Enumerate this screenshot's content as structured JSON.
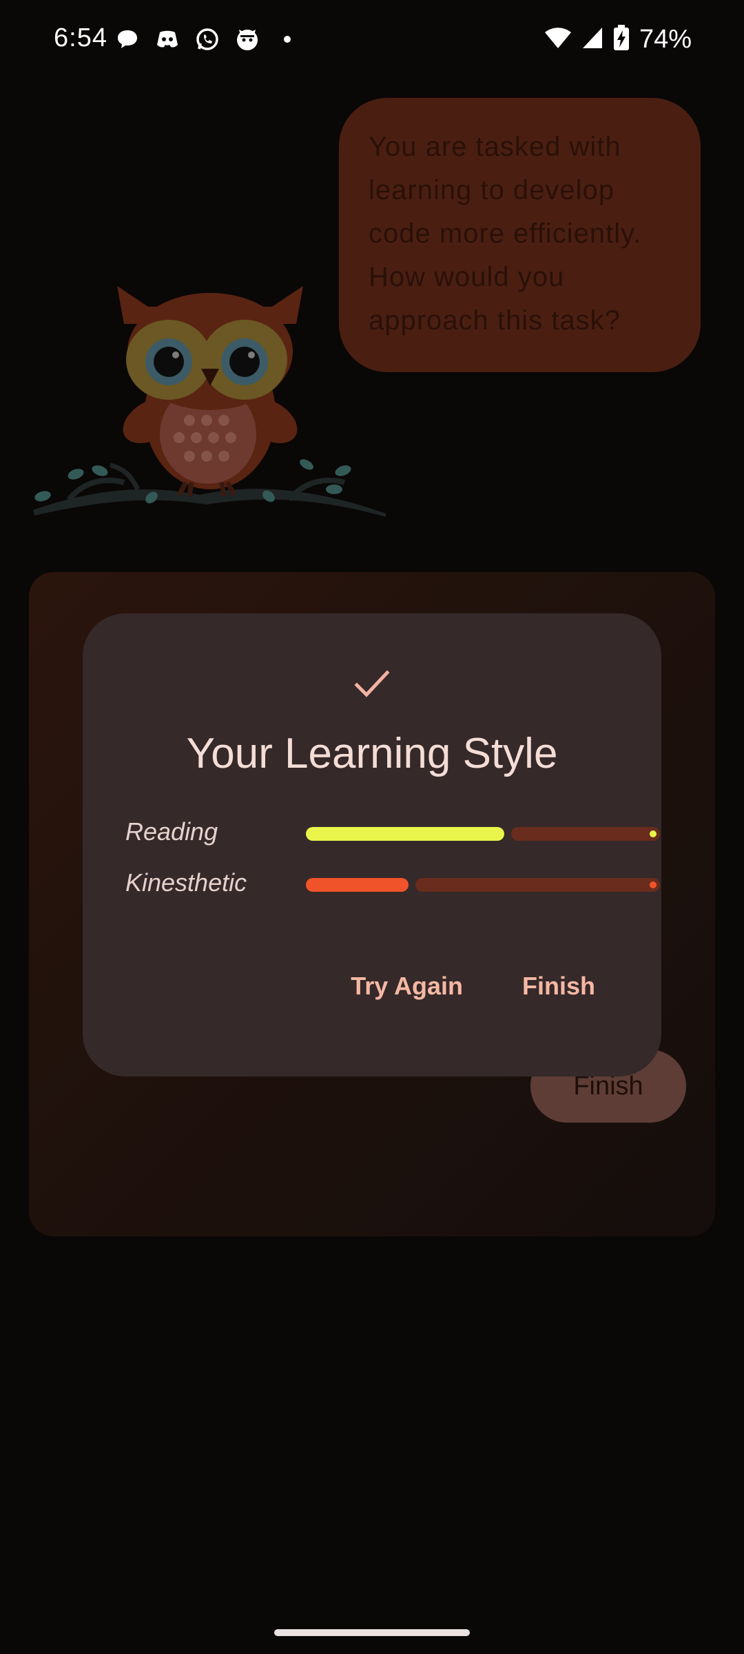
{
  "status_bar": {
    "time": "6:54",
    "left_icons": [
      "chat-bubble-icon",
      "discord-icon",
      "whatsapp-icon",
      "cat-icon",
      "dot-icon"
    ],
    "right_icons": [
      "wifi-icon",
      "signal-icon",
      "battery-charging-icon"
    ],
    "battery": "74%"
  },
  "speech_bubble": {
    "text": "You are tasked with learning to develop code more efficiently. How would you approach this task?"
  },
  "background_card": {
    "finish_label": "Finish"
  },
  "dialog": {
    "title": "Your Learning Style",
    "styles": [
      {
        "label": "Reading",
        "progress": 0.56,
        "color": "#e9f54a",
        "track_color": "#6a2c1c"
      },
      {
        "label": "Kinesthetic",
        "progress": 0.29,
        "color": "#f0532a",
        "track_color": "#6a2c1c"
      }
    ],
    "try_again_label": "Try Again",
    "finish_label": "Finish"
  },
  "colors": {
    "background": "#0a0707",
    "dialog": "#352929",
    "accent_text": "#f6b8a4",
    "bubble": "#4a1f11"
  }
}
